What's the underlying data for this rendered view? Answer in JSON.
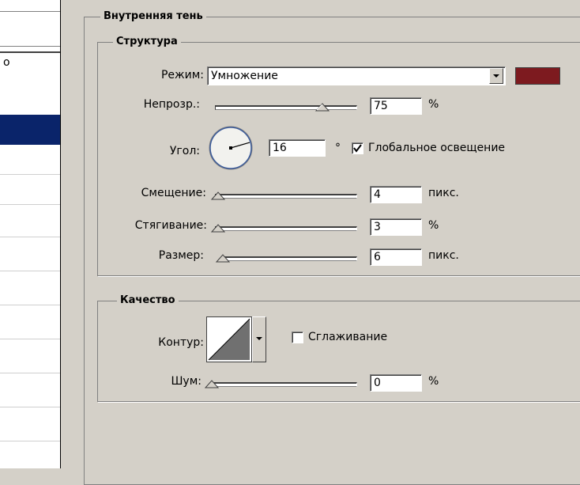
{
  "left_list": {
    "fragment_text": "о",
    "selected_row_index": 0,
    "row_count": 10
  },
  "inner_shadow": {
    "title": "Внутренняя тень",
    "structure": {
      "title": "Структура",
      "mode_label": "Режим:",
      "mode_value": "Умножение",
      "color": "#7d1a1f",
      "opacity_label": "Непрозр.:",
      "opacity_value": "75",
      "opacity_unit": "%",
      "opacity_level": 75,
      "angle_label": "Угол:",
      "angle_value": "16",
      "angle_unit": "°",
      "angle_degrees": 16,
      "global_light_checked": true,
      "global_light_label": "Глобальное освещение",
      "distance_label": "Смещение:",
      "distance_value": "4",
      "distance_unit": "пикс.",
      "choke_label": "Стягивание:",
      "choke_value": "3",
      "choke_unit": "%",
      "size_label": "Размер:",
      "size_value": "6",
      "size_unit": "пикс."
    },
    "quality": {
      "title": "Качество",
      "contour_label": "Контур:",
      "antialias_checked": false,
      "antialias_label": "Сглаживание",
      "noise_label": "Шум:",
      "noise_value": "0",
      "noise_unit": "%"
    }
  }
}
